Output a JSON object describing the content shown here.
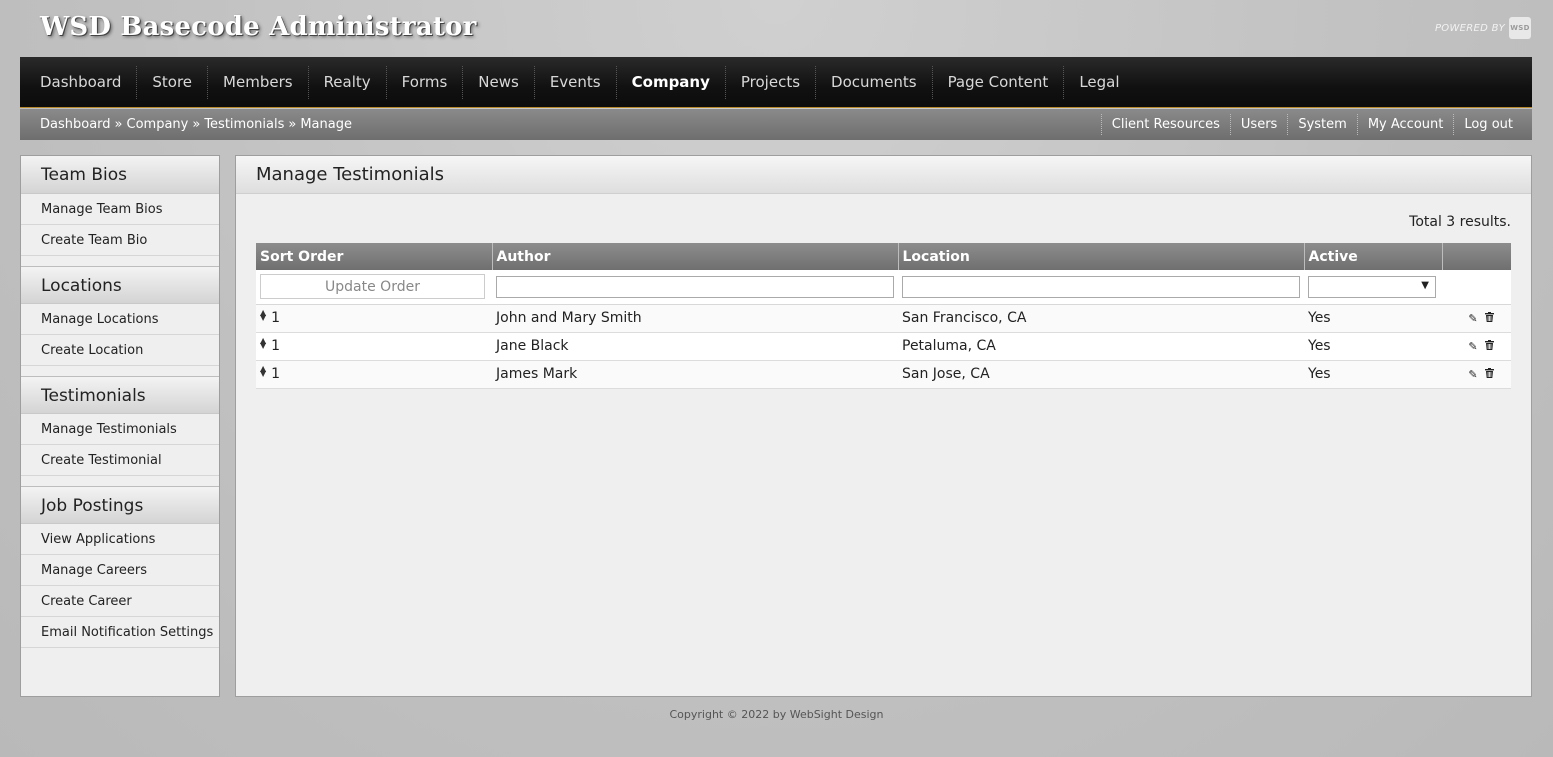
{
  "app": {
    "title": "WSD Basecode Administrator",
    "powered_by": "POWERED BY",
    "logo_text": "WSD"
  },
  "nav": {
    "items": [
      {
        "label": "Dashboard"
      },
      {
        "label": "Store"
      },
      {
        "label": "Members"
      },
      {
        "label": "Realty"
      },
      {
        "label": "Forms"
      },
      {
        "label": "News"
      },
      {
        "label": "Events"
      },
      {
        "label": "Company",
        "active": true
      },
      {
        "label": "Projects"
      },
      {
        "label": "Documents"
      },
      {
        "label": "Page Content"
      },
      {
        "label": "Legal"
      }
    ]
  },
  "breadcrumb": {
    "items": [
      "Dashboard",
      "Company",
      "Testimonials",
      "Manage"
    ],
    "separator": "»"
  },
  "util_links": [
    "Client Resources",
    "Users",
    "System",
    "My Account",
    "Log out"
  ],
  "sidebar": {
    "sections": [
      {
        "title": "Team Bios",
        "items": [
          "Manage Team Bios",
          "Create Team Bio"
        ]
      },
      {
        "title": "Locations",
        "items": [
          "Manage Locations",
          "Create Location"
        ]
      },
      {
        "title": "Testimonials",
        "items": [
          "Manage Testimonials",
          "Create Testimonial"
        ]
      },
      {
        "title": "Job Postings",
        "items": [
          "View Applications",
          "Manage Careers",
          "Create Career",
          "Email Notification Settings"
        ]
      }
    ]
  },
  "main": {
    "title": "Manage Testimonials",
    "total": "Total 3 results.",
    "table": {
      "headers": [
        "Sort Order",
        "Author",
        "Location",
        "Active",
        ""
      ],
      "update_order_label": "Update Order",
      "active_filter_value": "",
      "rows": [
        {
          "sort": "1",
          "author": "John and Mary Smith",
          "location": "San Francisco, CA",
          "active": "Yes"
        },
        {
          "sort": "1",
          "author": "Jane Black",
          "location": "Petaluma, CA",
          "active": "Yes"
        },
        {
          "sort": "1",
          "author": "James Mark",
          "location": "San Jose, CA",
          "active": "Yes"
        }
      ]
    }
  },
  "footer": {
    "text": "Copyright © 2022 by WebSight Design"
  },
  "icons": {
    "sort_handle": "sort-arrows-icon",
    "edit": "pencil-icon",
    "delete": "trash-icon"
  },
  "colors": {
    "nav_bg": "#111111",
    "nav_accent": "#b8892b",
    "subbar_bg": "#7c7c7c",
    "table_head_bg": "#7e7e7e"
  }
}
